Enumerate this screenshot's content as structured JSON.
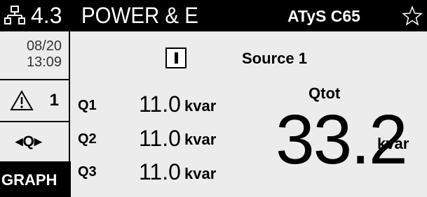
{
  "header": {
    "icon": "network-hierarchy-icon",
    "code": "4.3",
    "title": "POWER & E",
    "device": "ATyS C65",
    "star_icon": "star-outline-icon",
    "background": "#000000",
    "foreground": "#ffffff"
  },
  "sidebar": {
    "date": "08/20",
    "time": "13:09",
    "alarm_icon": "warning-triangle-icon",
    "alarm_count": "1",
    "nav_label": "◂Q▸",
    "graph_label": "GRAPH"
  },
  "main": {
    "switch_icon": "switch-position-icon",
    "source_label": "Source 1",
    "rows": [
      {
        "label": "Q1",
        "value": "11.0",
        "unit": "kvar"
      },
      {
        "label": "Q2",
        "value": "11.0",
        "unit": "kvar"
      },
      {
        "label": "Q3",
        "value": "11.0",
        "unit": "kvar"
      }
    ],
    "total": {
      "label": "Qtot",
      "value": "33.2",
      "unit": "kvar"
    }
  }
}
